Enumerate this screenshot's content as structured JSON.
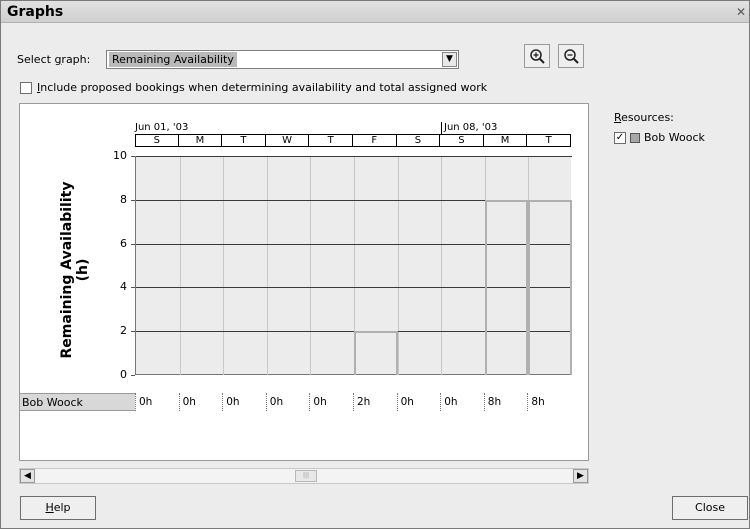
{
  "window": {
    "title": "Graphs"
  },
  "select_graph": {
    "label_pre": "Select ",
    "label_underline": "g",
    "label_post": "raph:",
    "value": "Remaining Availability"
  },
  "include_proposed": {
    "underline": "I",
    "label": "nclude proposed bookings when determining availability and total assigned work",
    "checked": false
  },
  "resources": {
    "label_underline": "R",
    "label": "esources:",
    "items": [
      {
        "name": "Bob Woock",
        "checked": true,
        "color": "#a8a8a8"
      }
    ]
  },
  "timescale": {
    "weeks": [
      {
        "label": "Jun 01, '03"
      },
      {
        "label": "Jun 08, '03"
      }
    ],
    "days": [
      "S",
      "M",
      "T",
      "W",
      "T",
      "F",
      "S",
      "S",
      "M",
      "T"
    ]
  },
  "chart_data": {
    "type": "bar",
    "ylabel": "Remaining Availability (h)",
    "xlabel": "",
    "title": "",
    "categories": [
      "S",
      "M",
      "T",
      "W",
      "T",
      "F",
      "S",
      "S",
      "M",
      "T"
    ],
    "series": [
      {
        "name": "Bob Woock",
        "values": [
          0,
          0,
          0,
          0,
          0,
          2,
          0,
          0,
          8,
          8
        ]
      }
    ],
    "ylim": [
      0,
      10
    ],
    "yticks": [
      0,
      2,
      4,
      6,
      8,
      10
    ],
    "grid": true
  },
  "row": {
    "label": "Bob Woock",
    "values": [
      "0h",
      "0h",
      "0h",
      "0h",
      "0h",
      "2h",
      "0h",
      "0h",
      "8h",
      "8h"
    ]
  },
  "buttons": {
    "help_underline": "H",
    "help": "elp",
    "close": "Close"
  },
  "icons": {
    "zoom_in": "zoom-in-icon",
    "zoom_out": "zoom-out-icon"
  }
}
